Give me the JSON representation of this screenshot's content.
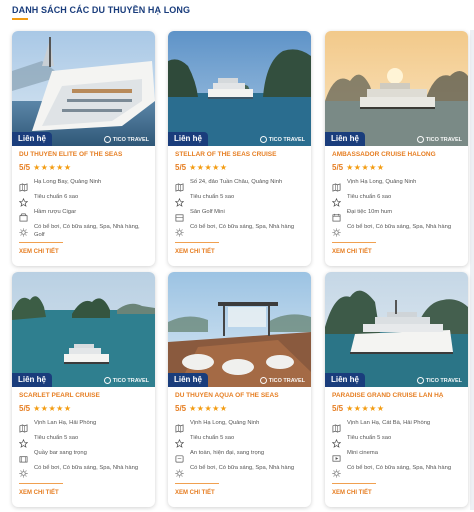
{
  "section": {
    "title": "DANH SÁCH CÁC DU THUYỀN HẠ LONG"
  },
  "colors": {
    "accent": "#e67e22",
    "navy": "#1a3d7c",
    "star": "#f39c12"
  },
  "cards": [
    {
      "name": "DU THUYỀN ELITE OF THE SEAS",
      "rating": "5/5",
      "stars": "★★★★★",
      "contact": "Liên hệ",
      "watermark": "TICO TRAVEL",
      "info": [
        {
          "icon": "map-pin-icon",
          "text": "Hạ Long Bay, Quảng Ninh"
        },
        {
          "icon": "star-outline-icon",
          "text": "Tiêu chuẩn 6 sao"
        },
        {
          "icon": "wine-icon",
          "text": "Hầm rượu Cigar"
        },
        {
          "icon": "sun-icon",
          "text": "Có bể bơi, Có bữa sáng, Spa, Nhà hàng, Golf"
        }
      ],
      "more": "XEM CHI TIẾT"
    },
    {
      "name": "STELLAR OF THE SEAS CRUISE",
      "rating": "5/5",
      "stars": "★★★★★",
      "contact": "Liên hệ",
      "watermark": "TICO TRAVEL",
      "info": [
        {
          "icon": "map-pin-icon",
          "text": "Số 24, đảo Tuần Châu, Quảng Ninh"
        },
        {
          "icon": "star-outline-icon",
          "text": "Tiêu chuẩn 5 sao"
        },
        {
          "icon": "golf-icon",
          "text": "Sân Golf Mini"
        },
        {
          "icon": "sun-icon",
          "text": "Có bể bơi, Có bữa sáng, Spa, Nhà hàng"
        }
      ],
      "more": "XEM CHI TIẾT"
    },
    {
      "name": "AMBASSADOR CRUISE HALONG",
      "rating": "5/5",
      "stars": "★★★★★",
      "contact": "Liên hệ",
      "watermark": "TICO TRAVEL",
      "info": [
        {
          "icon": "map-pin-icon",
          "text": "Vịnh Hạ Long, Quảng Ninh"
        },
        {
          "icon": "star-outline-icon",
          "text": "Tiêu chuẩn 6 sao"
        },
        {
          "icon": "calendar-icon",
          "text": "Đại tiệc 10m hum"
        },
        {
          "icon": "sun-icon",
          "text": "Có bể bơi, Có bữa sáng, Spa, Nhà hàng"
        }
      ],
      "more": "XEM CHI TIẾT"
    },
    {
      "name": "SCARLET PEARL CRUISE",
      "rating": "5/5",
      "stars": "★★★★★",
      "contact": "Liên hệ",
      "watermark": "TICO TRAVEL",
      "info": [
        {
          "icon": "map-pin-icon",
          "text": "Vịnh Lan Hạ, Hải Phòng"
        },
        {
          "icon": "star-outline-icon",
          "text": "Tiêu chuẩn 5 sao"
        },
        {
          "icon": "bar-icon",
          "text": "Quầy bar sang trọng"
        },
        {
          "icon": "sun-icon",
          "text": "Có bể bơi, Có bữa sáng, Spa, Nhà hàng"
        }
      ],
      "more": "XEM CHI TIẾT"
    },
    {
      "name": "DU THUYỀN AQUA OF THE SEAS",
      "rating": "5/5",
      "stars": "★★★★★",
      "contact": "Liên hệ",
      "watermark": "TICO TRAVEL",
      "info": [
        {
          "icon": "map-pin-icon",
          "text": "Vịnh Hạ Long, Quảng Ninh"
        },
        {
          "icon": "star-outline-icon",
          "text": "Tiêu chuẩn 5 sao"
        },
        {
          "icon": "shield-icon",
          "text": "An toàn, hiện đại, sang trọng"
        },
        {
          "icon": "sun-icon",
          "text": "Có bể bơi, Có bữa sáng, Spa, Nhà hàng"
        }
      ],
      "more": "XEM CHI TIẾT"
    },
    {
      "name": "PARADISE GRAND CRUISE LAN HẠ",
      "rating": "5/5",
      "stars": "★★★★★",
      "contact": "Liên hệ",
      "watermark": "TICO TRAVEL",
      "info": [
        {
          "icon": "map-pin-icon",
          "text": "Vịnh Lan Hạ, Cát Bà, Hải Phòng"
        },
        {
          "icon": "star-outline-icon",
          "text": "Tiêu chuẩn 5 sao"
        },
        {
          "icon": "film-icon",
          "text": "Mini cinema"
        },
        {
          "icon": "sun-icon",
          "text": "Có bể bơi, Có bữa sáng, Spa, Nhà hàng"
        }
      ],
      "more": "XEM CHI TIẾT"
    }
  ]
}
